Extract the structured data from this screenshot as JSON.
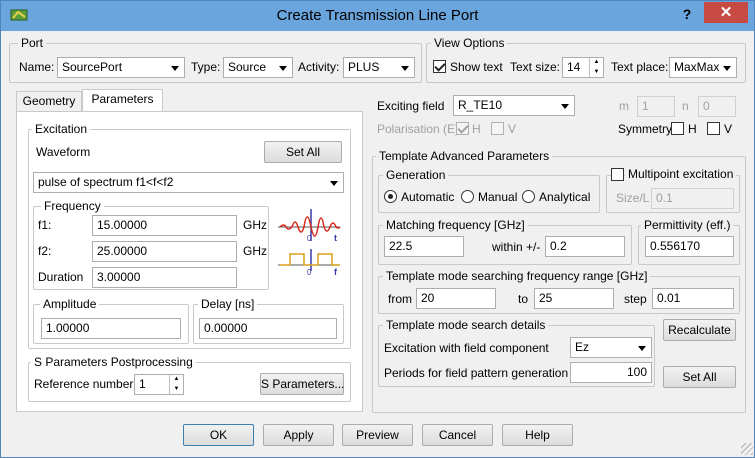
{
  "title": "Create Transmission Line Port",
  "title_buttons": {
    "help": "?",
    "close": "✕"
  },
  "icons": [
    "app-icon",
    "chevron-down-icon",
    "spin-up-icon",
    "spin-down-icon",
    "waveform-diagram-icon"
  ],
  "port": {
    "group": "Port",
    "name_label": "Name:",
    "name_value": "SourcePort",
    "type_label": "Type:",
    "type_value": "Source",
    "activity_label": "Activity:",
    "activity_value": "PLUS"
  },
  "view_options": {
    "group": "View Options",
    "show_text": "Show text",
    "show_text_checked": true,
    "text_size_label": "Text size:",
    "text_size_value": "14",
    "text_place_label": "Text place:",
    "text_place_value": "MaxMax"
  },
  "tabs": [
    {
      "label": "Geometry",
      "selected": false
    },
    {
      "label": "Parameters",
      "selected": true
    }
  ],
  "excitation": {
    "group": "Excitation",
    "waveform_label": "Waveform",
    "set_all": "Set All",
    "waveform_value": "pulse of spectrum f1<f<f2",
    "frequency_group": "Frequency",
    "f1_label": "f1:",
    "f1_value": "15.00000",
    "f1_unit": "GHz",
    "f2_label": "f2:",
    "f2_value": "25.00000",
    "f2_unit": "GHz",
    "duration_label": "Duration",
    "duration_value": "3.00000",
    "diagram": {
      "t": "t",
      "zero1": "0",
      "f": "f",
      "zero2": "0"
    },
    "amplitude_group": "Amplitude",
    "amplitude_value": "1.00000",
    "delay_group": "Delay [ns]",
    "delay_value": "0.00000"
  },
  "s_params": {
    "group": "S Parameters Postprocessing",
    "ref_label": "Reference number:",
    "ref_value": "1",
    "button": "S Parameters..."
  },
  "exciting": {
    "field_label": "Exciting field",
    "field_value": "R_TE10",
    "m_label": "m",
    "m_value": "1",
    "n_label": "n",
    "n_value": "0",
    "pol_label": "Polarisation (E)",
    "pol_h": "H",
    "pol_h_checked": true,
    "pol_v": "V",
    "pol_v_checked": false,
    "symmetry_label": "Symmetry",
    "sym_h": "H",
    "sym_v": "V"
  },
  "template": {
    "group": "Template Advanced Parameters",
    "generation_group": "Generation",
    "automatic": "Automatic",
    "manual": "Manual",
    "analytical": "Analytical",
    "selected": "Automatic",
    "multipoint": "Multipoint excitation",
    "size_l_label": "Size/L",
    "size_l_value": "0.1",
    "matching_group": "Matching frequency [GHz]",
    "matching_value": "22.5",
    "within_label": "within +/-",
    "within_value": "0.2",
    "permittivity_group": "Permittivity (eff.)",
    "permittivity_value": "0.556170",
    "range_group": "Template mode searching frequency range [GHz]",
    "from_label": "from",
    "from_value": "20",
    "to_label": "to",
    "to_value": "25",
    "step_label": "step",
    "step_value": "0.01",
    "details_group": "Template mode search details",
    "excitation_label": "Excitation with field component",
    "excitation_value": "Ez",
    "periods_label": "Periods for field pattern generation",
    "periods_value": "100",
    "recalculate": "Recalculate",
    "set_all": "Set All"
  },
  "footer": {
    "ok": "OK",
    "apply": "Apply",
    "preview": "Preview",
    "cancel": "Cancel",
    "help": "Help"
  }
}
